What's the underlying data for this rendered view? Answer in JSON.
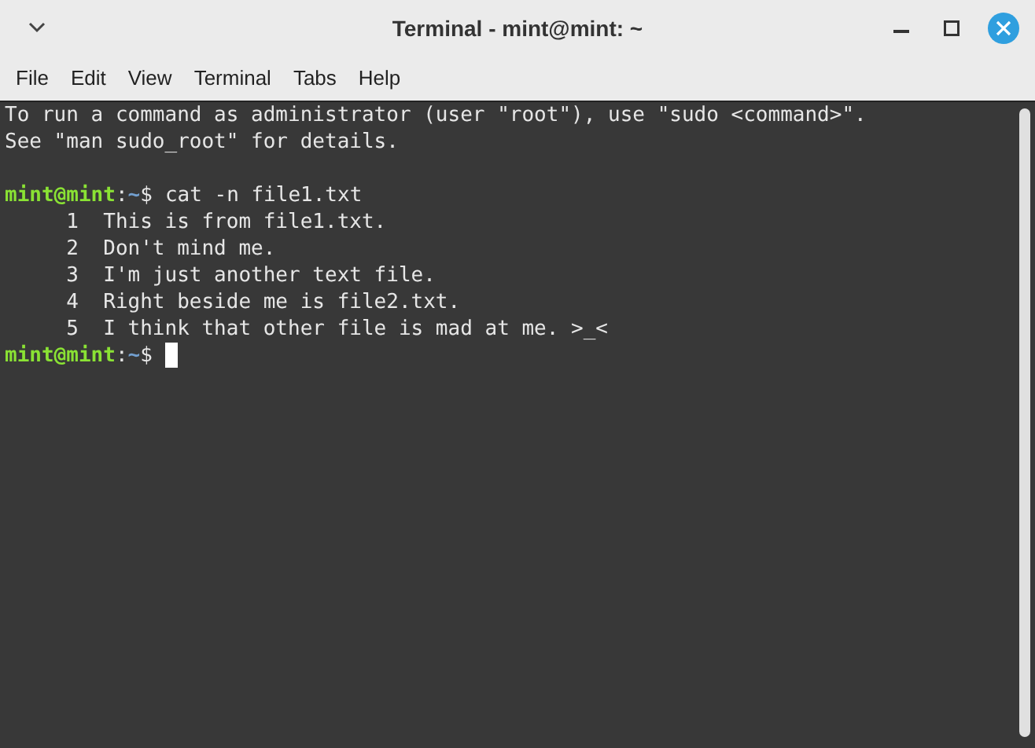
{
  "window": {
    "title": "Terminal - mint@mint: ~"
  },
  "menu": [
    {
      "label": "File"
    },
    {
      "label": "Edit"
    },
    {
      "label": "View"
    },
    {
      "label": "Terminal"
    },
    {
      "label": "Tabs"
    },
    {
      "label": "Help"
    }
  ],
  "terminal": {
    "lines": [
      {
        "kind": "text",
        "text": "To run a command as administrator (user \"root\"), use \"sudo <command>\"."
      },
      {
        "kind": "text",
        "text": "See \"man sudo_root\" for details."
      },
      {
        "kind": "blank"
      },
      {
        "kind": "prompt",
        "user_host": "mint@mint",
        "separator": ":",
        "path": "~",
        "symbol": "$",
        "command": "cat -n file1.txt"
      },
      {
        "kind": "text",
        "text": "     1  This is from file1.txt."
      },
      {
        "kind": "text",
        "text": "     2  Don't mind me."
      },
      {
        "kind": "text",
        "text": "     3  I'm just another text file."
      },
      {
        "kind": "text",
        "text": "     4  Right beside me is file2.txt."
      },
      {
        "kind": "text",
        "text": "     5  I think that other file is mad at me. >_<"
      },
      {
        "kind": "prompt",
        "user_host": "mint@mint",
        "separator": ":",
        "path": "~",
        "symbol": "$",
        "cursor": true
      }
    ]
  }
}
